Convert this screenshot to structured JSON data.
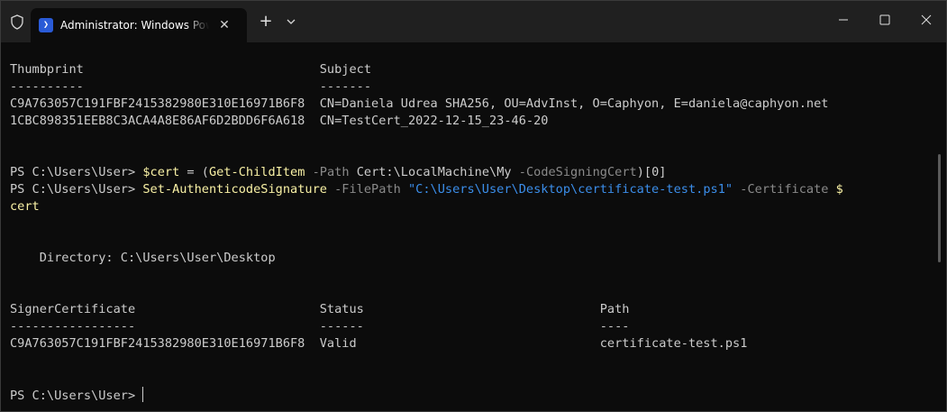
{
  "window": {
    "tab_title": "Administrator: Windows PowerShell",
    "ps_icon_glyph": "❯",
    "tab_close": "✕",
    "new_tab": "+",
    "accent": "#2a5bd7",
    "icons": {
      "shield": "shield-icon",
      "powershell": "powershell-icon",
      "close": "close-icon",
      "plus": "plus-icon",
      "dropdown": "chevron-down-icon",
      "minimize": "minimize-icon",
      "maximize": "maximize-icon",
      "window_close": "window-close-icon"
    }
  },
  "terminal": {
    "cert_table": {
      "header": "Thumbprint                                Subject",
      "divider": "----------                                -------",
      "rows": [
        "C9A763057C191FBF2415382980E310E16971B6F8  CN=Daniela Udrea SHA256, OU=AdvInst, O=Caphyon, E=daniela@caphyon.net",
        "1CBC898351EEB8C3ACA4A8E86AF6D2BDD6F6A618  CN=TestCert_2022-12-15_23-46-20"
      ]
    },
    "cmd1": {
      "prompt": "PS C:\\Users\\User> ",
      "var": "$cert",
      "eq": " = (",
      "cmdlet": "Get-ChildItem",
      "param1": " -Path",
      "arg1": " Cert:\\LocalMachine\\My",
      "param2": " -CodeSigningCert",
      "tail": ")[0]"
    },
    "cmd2": {
      "prompt": "PS C:\\Users\\User> ",
      "cmdlet": "Set-AuthenticodeSignature",
      "param1": " -FilePath",
      "str": " \"C:\\Users\\User\\Desktop\\certificate-test.ps1\"",
      "param2": " -Certificate",
      "var_a": " $",
      "var_b": "cert"
    },
    "directory_line": "    Directory: C:\\Users\\User\\Desktop",
    "sig_table": {
      "header": "SignerCertificate                         Status                                Path",
      "divider": "-----------------                         ------                                ----",
      "row": "C9A763057C191FBF2415382980E310E16971B6F8  Valid                                 certificate-test.ps1"
    },
    "final_prompt": "PS C:\\Users\\User> "
  }
}
